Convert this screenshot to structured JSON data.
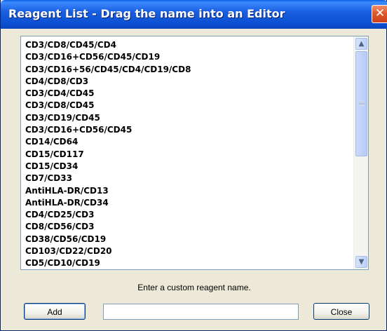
{
  "window": {
    "title": "Reagent List - Drag the name into an Editor",
    "close_glyph": "✕"
  },
  "reagents": [
    "CD3/CD8/CD45/CD4",
    "CD3/CD16+CD56/CD45/CD19",
    "CD3/CD16+56/CD45/CD4/CD19/CD8",
    "CD4/CD8/CD3",
    "CD3/CD4/CD45",
    "CD3/CD8/CD45",
    "CD3/CD19/CD45",
    "CD3/CD16+CD56/CD45",
    "CD14/CD64",
    "CD15/CD117",
    "CD15/CD34",
    "CD7/CD33",
    "AntiHLA-DR/CD13",
    "AntiHLA-DR/CD34",
    "CD4/CD25/CD3",
    "CD8/CD56/CD3",
    "CD38/CD56/CD19",
    "CD103/CD22/CD20",
    "CD5/CD10/CD19"
  ],
  "scrollbar": {
    "up_icon": "chevron-up-icon",
    "down_icon": "chevron-down-icon",
    "up_glyph": "▲",
    "down_glyph": "▼"
  },
  "custom": {
    "hint": "Enter a custom reagent name.",
    "input_value": "",
    "add_label": "Add",
    "close_label": "Close"
  }
}
